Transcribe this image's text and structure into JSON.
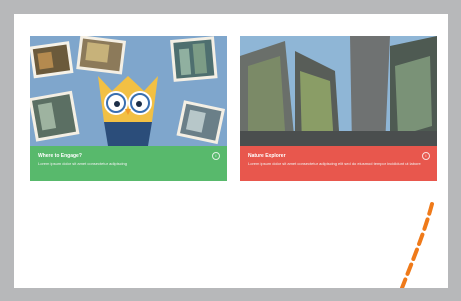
{
  "cards": [
    {
      "title": "Where to Engage?",
      "description": "Lorem ipsum dolor sit amet consectetur adipiscing",
      "info_icon": "info-icon",
      "footer_color": "#58b96c"
    },
    {
      "title": "Nature Explorer",
      "description": "Lorem ipsum dolor sit amet consectetur adipiscing elit sed do eiusmod tempor incididunt ut labore",
      "info_icon": "info-icon",
      "footer_color": "#e8574d"
    }
  ],
  "colors": {
    "background": "#b7b8ba",
    "panel": "#ffffff",
    "dash_accent": "#ef7a1a"
  }
}
